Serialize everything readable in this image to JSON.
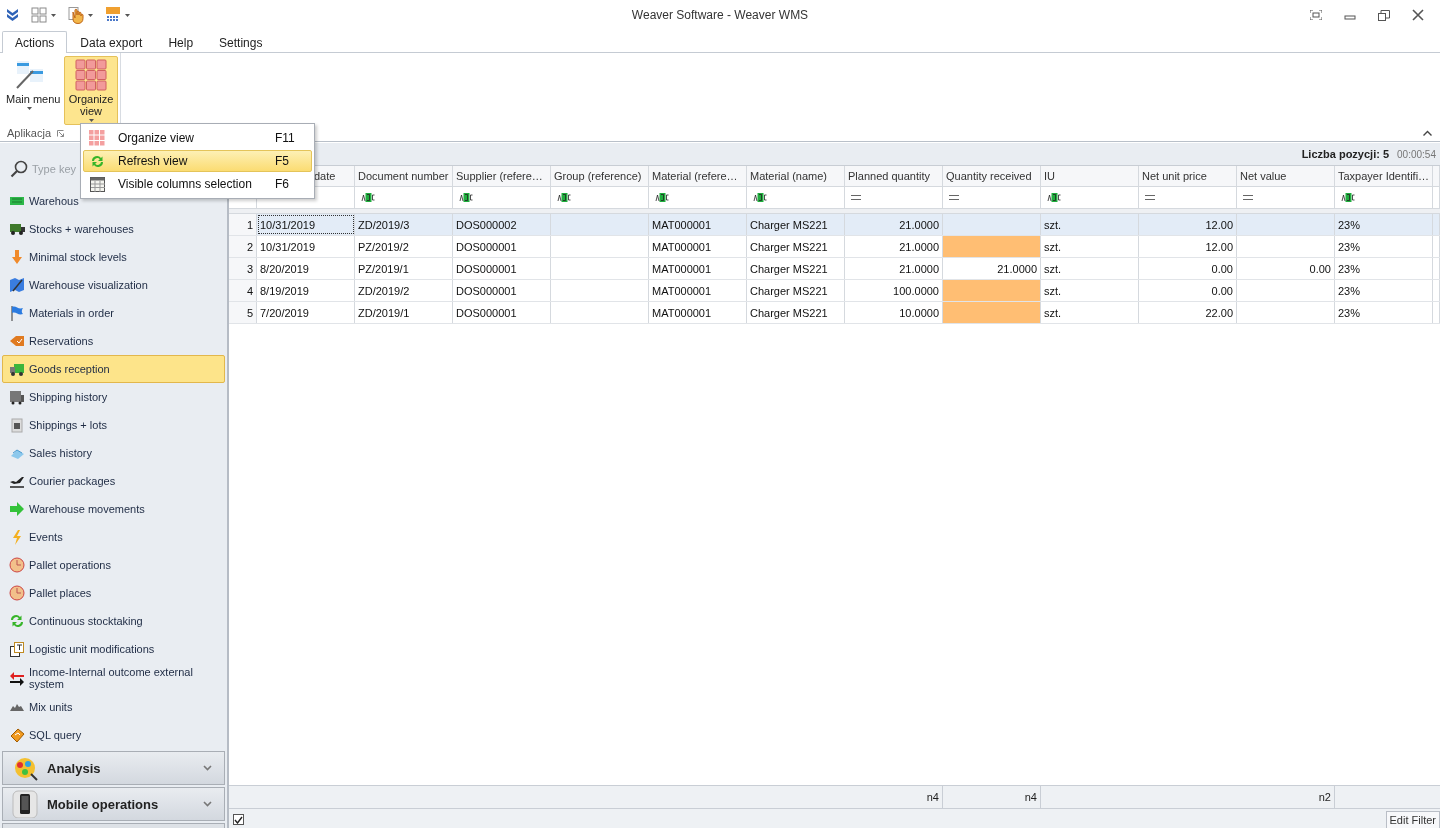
{
  "window": {
    "title": "Weaver Software - Weaver WMS"
  },
  "ribbon_tabs": [
    {
      "label": "Actions",
      "selected": true
    },
    {
      "label": "Data export",
      "selected": false
    },
    {
      "label": "Help",
      "selected": false
    },
    {
      "label": "Settings",
      "selected": false
    }
  ],
  "ribbon": {
    "buttons": [
      {
        "label": "Main menu",
        "selected": false
      },
      {
        "label": "Organize view",
        "selected": true
      }
    ],
    "group_label": "Aplikacja"
  },
  "dropdown_menu": [
    {
      "label": "Organize view",
      "shortcut": "F11",
      "selected": false
    },
    {
      "label": "Refresh view",
      "shortcut": "F5",
      "selected": true
    },
    {
      "label": "Visible columns selection",
      "shortcut": "F6",
      "selected": false
    }
  ],
  "sidebar": {
    "search_placeholder": "Type key",
    "items": [
      {
        "label": "Warehous",
        "selected": false
      },
      {
        "label": "Stocks + warehouses",
        "selected": false
      },
      {
        "label": "Minimal stock levels",
        "selected": false
      },
      {
        "label": "Warehouse visualization",
        "selected": false
      },
      {
        "label": "Materials in order",
        "selected": false
      },
      {
        "label": "Reservations",
        "selected": false
      },
      {
        "label": "Goods reception",
        "selected": true
      },
      {
        "label": "Shipping history",
        "selected": false
      },
      {
        "label": "Shippings + lots",
        "selected": false
      },
      {
        "label": "Sales history",
        "selected": false
      },
      {
        "label": "Courier packages",
        "selected": false
      },
      {
        "label": "Warehouse movements",
        "selected": false
      },
      {
        "label": "Events",
        "selected": false
      },
      {
        "label": "Pallet operations",
        "selected": false
      },
      {
        "label": "Pallet places",
        "selected": false
      },
      {
        "label": "Continuous stocktaking",
        "selected": false
      },
      {
        "label": "Logistic unit modifications",
        "selected": false
      },
      {
        "label": "Income-Internal outcome external system",
        "selected": false
      },
      {
        "label": "Mix units",
        "selected": false
      },
      {
        "label": "SQL query",
        "selected": false
      }
    ],
    "groups": [
      {
        "label": "Analysis",
        "expanded": false
      },
      {
        "label": "Mobile operations",
        "expanded": false
      }
    ]
  },
  "grid": {
    "count_label": "Liczba pozycji: 5",
    "timer": "00:00:54",
    "columns": [
      {
        "label": "date"
      },
      {
        "label": "Document number",
        "kind": "text"
      },
      {
        "label": "Supplier (refere…",
        "kind": "text"
      },
      {
        "label": "Group (reference)",
        "kind": "text"
      },
      {
        "label": "Material (refere…",
        "kind": "text"
      },
      {
        "label": "Material (name)",
        "kind": "text"
      },
      {
        "label": "Planned quantity",
        "kind": "number",
        "summary": "n4"
      },
      {
        "label": "Quantity received",
        "kind": "number",
        "summary": "n4"
      },
      {
        "label": "IU",
        "kind": "text"
      },
      {
        "label": "Net unit price",
        "kind": "number"
      },
      {
        "label": "Net value",
        "kind": "number",
        "summary": "n2"
      },
      {
        "label": "Taxpayer Identifi…",
        "kind": "text"
      }
    ],
    "rows": [
      {
        "number": "1",
        "selected": true,
        "highlight": false,
        "cells": [
          "10/31/2019",
          "ZD/2019/3",
          "DOS000002",
          "",
          "MAT000001",
          "Charger MS221",
          "21.0000",
          "",
          "szt.",
          "12.00",
          "",
          "23%"
        ]
      },
      {
        "number": "2",
        "selected": false,
        "highlight": true,
        "cells": [
          "10/31/2019",
          "PZ/2019/2",
          "DOS000001",
          "",
          "MAT000001",
          "Charger MS221",
          "21.0000",
          "",
          "szt.",
          "12.00",
          "",
          "23%"
        ]
      },
      {
        "number": "3",
        "selected": false,
        "highlight": false,
        "cells": [
          "8/20/2019",
          "PZ/2019/1",
          "DOS000001",
          "",
          "MAT000001",
          "Charger MS221",
          "21.0000",
          "21.0000",
          "szt.",
          "0.00",
          "0.00",
          "23%"
        ]
      },
      {
        "number": "4",
        "selected": false,
        "highlight": true,
        "cells": [
          "8/19/2019",
          "ZD/2019/2",
          "DOS000001",
          "",
          "MAT000001",
          "Charger MS221",
          "100.0000",
          "",
          "szt.",
          "0.00",
          "",
          "23%"
        ]
      },
      {
        "number": "5",
        "selected": false,
        "highlight": true,
        "cells": [
          "7/20/2019",
          "ZD/2019/1",
          "DOS000001",
          "",
          "MAT000001",
          "Charger MS221",
          "10.0000",
          "",
          "szt.",
          "22.00",
          "",
          "23%"
        ]
      }
    ],
    "filter_enabled": true,
    "edit_filter_button": "Edit Filter"
  }
}
